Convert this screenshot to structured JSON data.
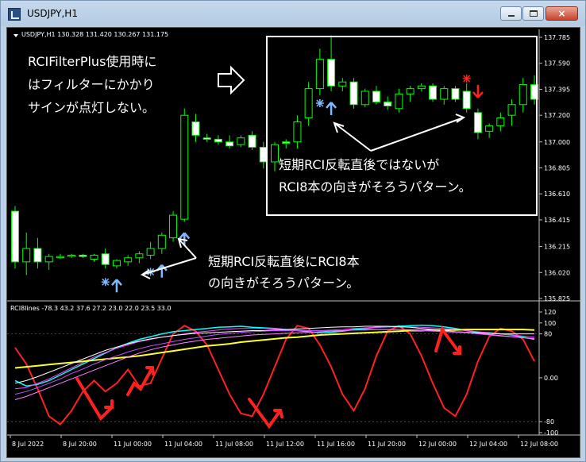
{
  "window": {
    "title": "USDJPY,H1",
    "buttons": {
      "minimize_glyph": "–",
      "maximize_glyph": "□",
      "close_glyph": "×"
    }
  },
  "main_chart": {
    "header": "USDJPY,H1  130.328 131.420 130.267 131.175",
    "price_ticks": [
      "137.785",
      "137.590",
      "137.395",
      "137.200",
      "137.000",
      "136.805",
      "136.610",
      "136.415",
      "136.215",
      "136.020",
      "135.825"
    ],
    "annotations": {
      "left_lines": [
        "RCIFilterPlus使用時に",
        "はフィルターにかかり",
        "サインが点灯しない。"
      ],
      "box_lines": [
        "短期RCI反転直後ではないが",
        "RCI8本の向きがそろうパターン。"
      ],
      "bottom_lines": [
        "短期RCI反転直後にRCI8本",
        "の向きがそろうパターン。"
      ]
    }
  },
  "indicator": {
    "header": "RCI8lines -78.3 43.2 37.6 27.2 23.0 22.0 23.5 33.0",
    "ticks": [
      "120",
      "100",
      "80",
      "0.00",
      "-80",
      "-100"
    ]
  },
  "time_axis": [
    "8 Jul 2022",
    "8 Jul 20:00",
    "11 Jul 00:00",
    "11 Jul 04:00",
    "11 Jul 08:00",
    "11 Jul 12:00",
    "11 Jul 16:00",
    "11 Jul 20:00",
    "12 Jul 00:00",
    "12 Jul 04:00",
    "12 Jul 08:00"
  ],
  "chart_data": {
    "type": "candlestick",
    "symbol": "USDJPY",
    "timeframe": "H1",
    "ylim": [
      135.825,
      137.785
    ],
    "candles": [
      [
        136.48,
        136.52,
        136.05,
        136.1
      ],
      [
        136.1,
        136.32,
        136.0,
        136.2
      ],
      [
        136.2,
        136.28,
        136.05,
        136.1
      ],
      [
        136.1,
        136.16,
        136.04,
        136.14
      ],
      [
        136.14,
        136.16,
        136.12,
        136.14
      ],
      [
        136.15,
        136.16,
        136.13,
        136.15
      ],
      [
        136.15,
        136.16,
        136.13,
        136.14
      ],
      [
        136.12,
        136.16,
        136.1,
        136.15
      ],
      [
        136.16,
        136.2,
        136.05,
        136.08
      ],
      [
        136.07,
        136.12,
        136.05,
        136.11
      ],
      [
        136.1,
        136.15,
        136.07,
        136.13
      ],
      [
        136.13,
        136.18,
        136.09,
        136.16
      ],
      [
        136.15,
        136.25,
        136.12,
        136.2
      ],
      [
        136.2,
        136.32,
        136.16,
        136.3
      ],
      [
        136.28,
        136.48,
        136.25,
        136.45
      ],
      [
        136.42,
        137.25,
        136.4,
        137.2
      ],
      [
        137.15,
        137.21,
        137.0,
        137.05
      ],
      [
        137.03,
        137.06,
        137.0,
        137.02
      ],
      [
        137.02,
        137.05,
        136.98,
        137.0
      ],
      [
        137.0,
        137.05,
        136.95,
        136.97
      ],
      [
        136.98,
        137.05,
        136.96,
        137.03
      ],
      [
        137.05,
        137.08,
        136.94,
        136.96
      ],
      [
        136.96,
        137.0,
        136.8,
        136.85
      ],
      [
        136.85,
        137.0,
        136.78,
        136.98
      ],
      [
        137.0,
        137.02,
        136.95,
        136.99
      ],
      [
        137.0,
        137.2,
        136.95,
        137.15
      ],
      [
        137.18,
        137.45,
        137.12,
        137.4
      ],
      [
        137.4,
        137.7,
        137.35,
        137.62
      ],
      [
        137.62,
        137.8,
        137.38,
        137.42
      ],
      [
        137.42,
        137.48,
        137.38,
        137.45
      ],
      [
        137.45,
        137.48,
        137.25,
        137.28
      ],
      [
        137.28,
        137.4,
        137.26,
        137.38
      ],
      [
        137.38,
        137.42,
        137.28,
        137.3
      ],
      [
        137.3,
        137.34,
        137.24,
        137.27
      ],
      [
        137.25,
        137.4,
        137.22,
        137.36
      ],
      [
        137.36,
        137.42,
        137.3,
        137.4
      ],
      [
        137.4,
        137.44,
        137.38,
        137.42
      ],
      [
        137.42,
        137.44,
        137.3,
        137.32
      ],
      [
        137.32,
        137.42,
        137.28,
        137.4
      ],
      [
        137.4,
        137.42,
        137.3,
        137.32
      ],
      [
        137.38,
        137.44,
        137.22,
        137.25
      ],
      [
        137.22,
        137.25,
        137.02,
        137.07
      ],
      [
        137.08,
        137.14,
        137.03,
        137.12
      ],
      [
        137.12,
        137.22,
        137.08,
        137.18
      ],
      [
        137.2,
        137.32,
        137.12,
        137.28
      ],
      [
        137.28,
        137.48,
        137.22,
        137.43
      ],
      [
        137.43,
        137.5,
        137.28,
        137.32
      ]
    ],
    "rci_ylim": [
      -100,
      120
    ],
    "rci_series": [
      {
        "color": "#ff2020",
        "width": 2,
        "values": [
          55,
          25,
          -20,
          -70,
          -85,
          -60,
          -25,
          -5,
          -25,
          -10,
          15,
          -15,
          -10,
          35,
          80,
          95,
          85,
          60,
          15,
          -30,
          -65,
          -70,
          -30,
          20,
          70,
          95,
          90,
          60,
          20,
          -30,
          -60,
          -20,
          40,
          85,
          95,
          80,
          40,
          -10,
          -55,
          -70,
          -30,
          30,
          75,
          90,
          85,
          70,
          30
        ]
      },
      {
        "color": "#00ffff",
        "width": 1.5,
        "values": [
          -5,
          -15,
          -12,
          -5,
          5,
          15,
          25,
          35,
          45,
          55,
          63,
          70,
          75,
          80,
          84,
          86,
          88,
          90,
          92,
          93,
          94,
          92,
          91,
          90,
          88,
          86,
          84,
          82,
          83,
          85,
          88,
          90,
          92,
          93,
          94,
          95,
          96,
          95,
          93,
          90,
          86,
          83,
          82,
          80,
          78,
          74,
          70
        ]
      },
      {
        "color": "#ff40ff",
        "width": 1,
        "values": [
          -20,
          -18,
          -10,
          -2,
          8,
          18,
          28,
          38,
          46,
          54,
          60,
          66,
          70,
          74,
          77,
          80,
          83,
          85,
          87,
          89,
          90,
          90,
          90,
          89,
          88,
          87,
          86,
          86,
          87,
          88,
          90,
          91,
          92,
          93,
          93,
          93,
          92,
          91,
          90,
          88,
          86,
          84,
          82,
          80,
          78,
          76,
          74
        ]
      },
      {
        "color": "#ffff30",
        "width": 2,
        "values": [
          18,
          20,
          22,
          24,
          26,
          28,
          30,
          32,
          34,
          36,
          38,
          40,
          43,
          46,
          49,
          52,
          55,
          58,
          60,
          62,
          65,
          67,
          69,
          71,
          73,
          74,
          76,
          78,
          79,
          80,
          81,
          82,
          83,
          84,
          85,
          86,
          86,
          87,
          87,
          87,
          88,
          88,
          88,
          88,
          88,
          88,
          87
        ]
      },
      {
        "color": "#ffffff",
        "width": 1,
        "values": [
          -10,
          -5,
          2,
          10,
          18,
          26,
          34,
          42,
          50,
          56,
          62,
          67,
          71,
          74,
          77,
          79,
          81,
          82,
          83,
          84,
          85,
          86,
          86,
          87,
          88,
          89,
          90,
          91,
          92,
          93,
          93,
          94,
          94,
          94,
          93,
          92,
          90,
          88,
          86,
          84,
          83,
          82,
          81,
          80,
          80,
          80,
          80
        ]
      },
      {
        "color": "#c050ff",
        "width": 1,
        "values": [
          -30,
          -25,
          -18,
          -10,
          -2,
          8,
          16,
          25,
          33,
          40,
          47,
          53,
          58,
          62,
          66,
          70,
          73,
          76,
          79,
          81,
          83,
          84,
          85,
          86,
          86,
          86,
          86,
          86,
          86,
          86,
          87,
          88,
          88,
          88,
          88,
          87,
          86,
          85,
          84,
          83,
          82,
          80,
          78,
          76,
          75,
          73,
          72
        ]
      },
      {
        "color": "#ff80ff",
        "width": 1,
        "values": [
          -40,
          -34,
          -26,
          -18,
          -10,
          -2,
          6,
          14,
          22,
          30,
          38,
          45,
          51,
          56,
          60,
          64,
          67,
          70,
          72,
          74,
          76,
          78,
          79,
          80,
          81,
          82,
          83,
          84,
          85,
          86,
          87,
          87,
          88,
          88,
          88,
          88,
          87,
          86,
          85,
          84,
          83,
          81,
          79,
          77,
          75,
          73,
          71
        ]
      }
    ]
  }
}
